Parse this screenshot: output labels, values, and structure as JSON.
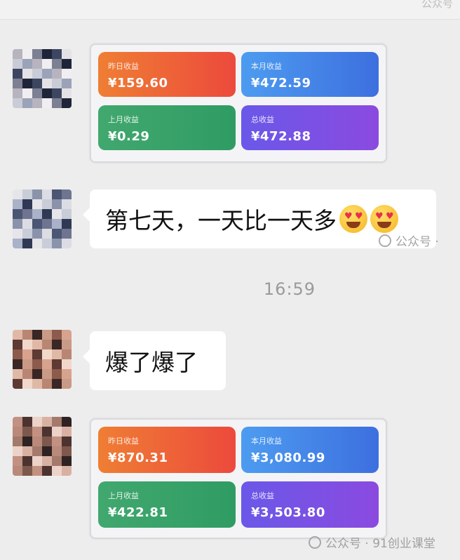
{
  "watermark": {
    "top": "公众号",
    "middle": "公众号 ·",
    "bottom": "公众号 · 91创业课堂"
  },
  "messages": [
    {
      "type": "earnings-card",
      "tiles": [
        {
          "label": "昨日收益",
          "value": "¥159.60",
          "color": "orange"
        },
        {
          "label": "本月收益",
          "value": "¥472.59",
          "color": "blue"
        },
        {
          "label": "上月收益",
          "value": "¥0.29",
          "color": "green"
        },
        {
          "label": "总收益",
          "value": "¥472.88",
          "color": "purple"
        }
      ]
    },
    {
      "type": "text",
      "text": "第七天，一天比一天多",
      "emoji": [
        "heart-eyes",
        "heart-eyes"
      ]
    },
    {
      "type": "timestamp",
      "text": "16:59"
    },
    {
      "type": "text",
      "text": "爆了爆了"
    },
    {
      "type": "earnings-card",
      "tiles": [
        {
          "label": "昨日收益",
          "value": "¥870.31",
          "color": "orange"
        },
        {
          "label": "本月收益",
          "value": "¥3,080.99",
          "color": "blue"
        },
        {
          "label": "上月收益",
          "value": "¥422.81",
          "color": "green"
        },
        {
          "label": "总收益",
          "value": "¥3,503.80",
          "color": "purple"
        }
      ]
    }
  ],
  "colors": {
    "background": "#ededed",
    "bubble": "#ffffff",
    "orange": "#ec4a3c",
    "blue": "#3d6fdf",
    "green": "#2f9c64",
    "purple": "#7a52e4"
  }
}
